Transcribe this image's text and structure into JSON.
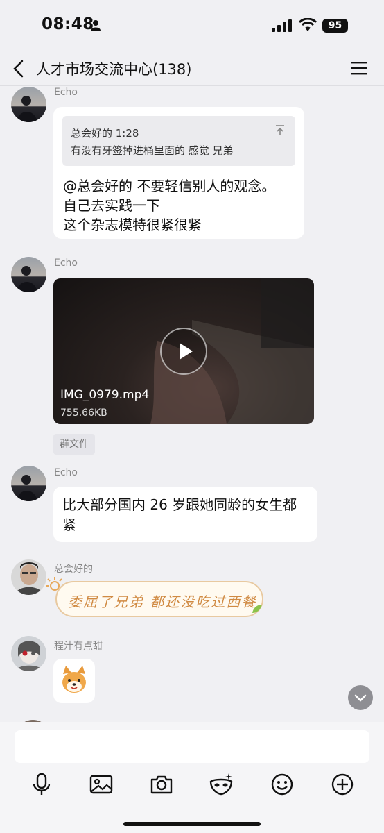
{
  "status_bar": {
    "time": "08:48",
    "battery": "95"
  },
  "header": {
    "title": "人才市场交流中心(138)"
  },
  "messages": [
    {
      "sender": "Echo",
      "quote": {
        "author_time": "总会好的 1:28",
        "text": "有没有牙签掉进桶里面的 感觉 兄弟"
      },
      "lines": [
        "@总会好的 不要轻信别人的观念。",
        "自己去实践一下",
        "这个杂志模特很紧很紧"
      ]
    },
    {
      "sender": "Echo",
      "video": {
        "filename": "IMG_0979.mp4",
        "size": "755.66KB"
      },
      "tag": "群文件"
    },
    {
      "sender": "Echo",
      "lines": [
        "比大部分国内 26 岁跟她同龄的女生都",
        "紧"
      ]
    },
    {
      "sender": "总会好的",
      "sticker_text": "委屈了兄弟 都还没吃过西餐"
    },
    {
      "sender": "程汁有点甜",
      "emoji": "shiba-dog-sticker"
    }
  ],
  "input": {
    "placeholder": ""
  },
  "toolbar": [
    "voice-icon",
    "image-icon",
    "camera-icon",
    "mask-icon",
    "emoji-icon",
    "plus-icon"
  ]
}
